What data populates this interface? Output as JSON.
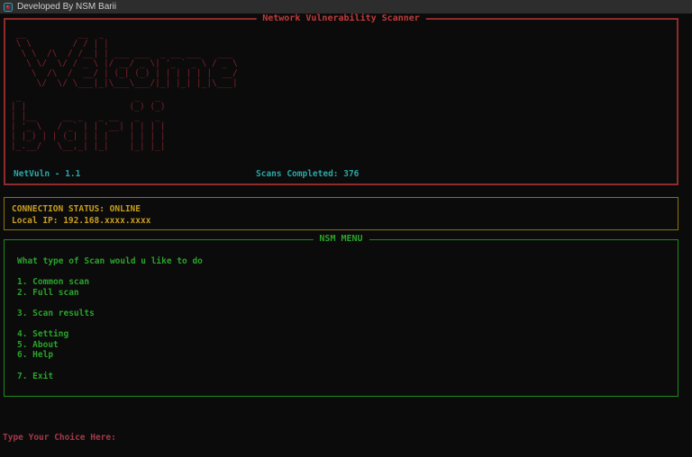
{
  "window": {
    "titlebar": {
      "title": "Developed By NSM Barii"
    }
  },
  "scanner_panel": {
    "title": "Network Vulnerability Scanner",
    "welcome_art": [
      " __          __  _                          ",
      " \\ \\        / / | |                         ",
      "  \\ \\  /\\  / /__| | ___ ___  _ __ ___   ___ ",
      "   \\ \\/  \\/ / _ \\ |/ __/ _ \\| '_ ` _ \\ / _ \\",
      "    \\  /\\  /  __/ | (_| (_) | | | | | |  __/",
      "     \\/  \\/ \\___|_|\\___\\___/|_| |_| |_|\\___|"
    ],
    "barii_art": [
      " _                      _   _  ",
      "| |                    (_) (_) ",
      "| |__     __ _   _ __   _   _  ",
      "| '_ \\   / _` | | '__| | | | | ",
      "| |_) | | (_| | | |    | | | | ",
      "|_.__/   \\__,_| |_|    |_| |_| "
    ],
    "version": "NetVuln - 1.1",
    "scans_completed": "Scans Completed: 376"
  },
  "status_panel": {
    "connection_status": "CONNECTION STATUS: ONLINE",
    "local_ip": "Local IP: 192.168.xxxx.xxxx"
  },
  "menu_panel": {
    "title": "NSM MENU",
    "lines": [
      "What type of Scan would u like to do",
      "",
      "1. Common scan",
      "2. Full scan",
      "",
      "3. Scan results",
      "",
      "4. Setting",
      "5. About",
      "6. Help",
      "",
      "7. Exit"
    ]
  },
  "prompt": {
    "label": "Type Your Choice Here:"
  },
  "colors": {
    "accent_red": "#8f2b2b",
    "accent_yellow": "#8d7407",
    "accent_green": "#1d8a1d",
    "text_teal": "#2ba7a3",
    "text_prompt": "#a5384a"
  }
}
